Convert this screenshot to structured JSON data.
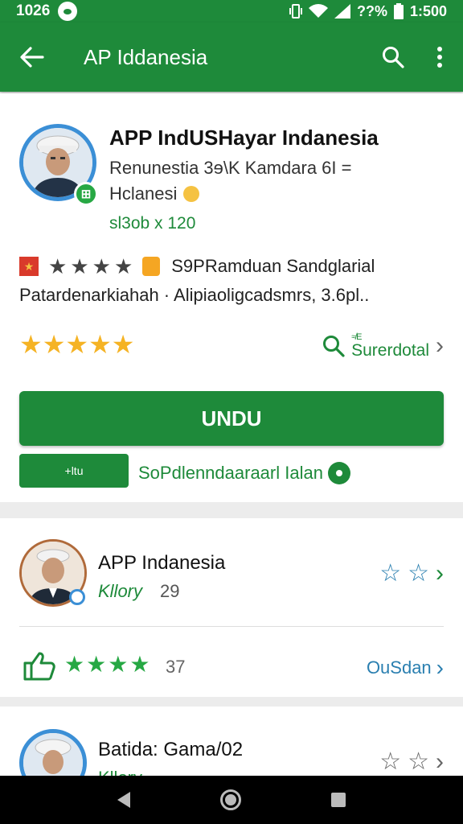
{
  "status_bar": {
    "time_left": "1026",
    "battery_text": "??%",
    "time_right": "1:500"
  },
  "app_bar": {
    "title": "AP Iddanesia"
  },
  "main_app": {
    "title": "APP IndUSHayar Indanesia",
    "subtitle_line1": "Renunestia 3ɘ\\K Kamdara 6I =",
    "subtitle_line2": "Hclanesi",
    "meta": "sl3ob x 120",
    "rating_text": "S9PRamduan Sandglarial",
    "description": "Patardenarkiahah · Alipiaoligcadsmrs, 3.6pl..",
    "gold_stars": "★★★★★",
    "search_tiny": "≉E",
    "search_label": "Surerdotal",
    "primary_button": "UNDU",
    "secondary_button": "+ltu",
    "secondary_link": "SoPdlenndaaraarl Ialan"
  },
  "list": [
    {
      "title": "APP Indanesia",
      "category": "Kllory",
      "count": "29",
      "rating_count": "37",
      "link": "OuSdan"
    },
    {
      "title": "Batida: Gama/02",
      "category": "Kllory"
    }
  ],
  "icons": {
    "back": "arrow-left",
    "search": "magnifier",
    "more": "vertical-dots"
  },
  "colors": {
    "primary_green": "#1e8a3a",
    "accent_gold": "#f5b324",
    "link_blue": "#2a7fb0"
  }
}
